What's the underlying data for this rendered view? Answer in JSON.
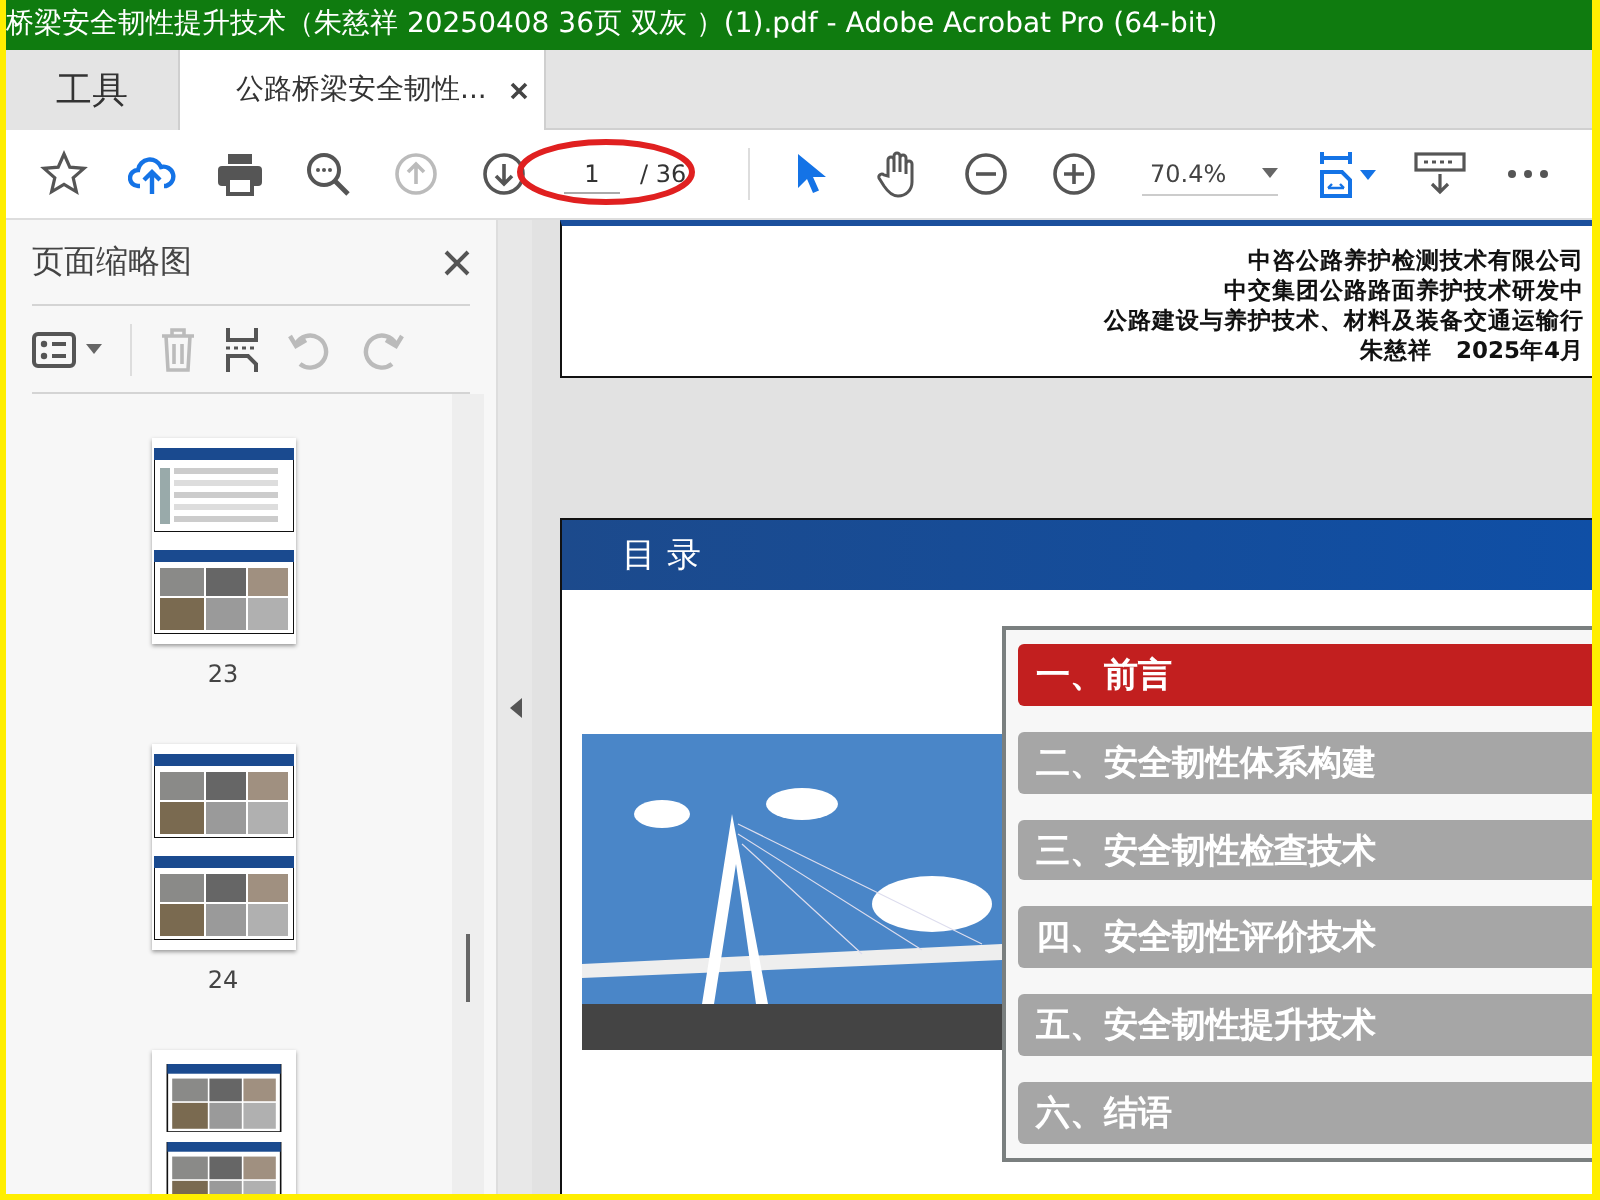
{
  "window": {
    "title": "桥梁安全韧性提升技术（朱慈祥 20250408 36页 双灰 ）(1).pdf - Adobe Acrobat Pro (64-bit)"
  },
  "tabs": [
    {
      "label": "工具",
      "selected": false
    },
    {
      "label": "公路桥梁安全韧性...",
      "selected": true
    }
  ],
  "toolbar": {
    "page_number": "1",
    "page_total": "/ 36",
    "zoom": "70.4%"
  },
  "sidebar": {
    "title": "页面缩略图",
    "thumbnails": [
      {
        "kind": "full",
        "label": "23"
      },
      {
        "kind": "full",
        "label": "24"
      },
      {
        "kind": "cut"
      }
    ]
  },
  "document": {
    "cover_lines": [
      "中咨公路养护检测技术有限公司",
      "中交集团公路路面养护技术研发中",
      "公路建设与养护技术、材料及装备交通运输行",
      "朱慈祥　2025年4月"
    ],
    "contents_heading": "目 录",
    "contents": [
      {
        "label": "一、前言",
        "selected": true
      },
      {
        "label": "二、安全韧性体系构建",
        "selected": false
      },
      {
        "label": "三、安全韧性检查技术",
        "selected": false
      },
      {
        "label": "四、安全韧性评价技术",
        "selected": false
      },
      {
        "label": "五、安全韧性提升技术",
        "selected": false
      },
      {
        "label": "六、结语",
        "selected": false
      }
    ]
  }
}
